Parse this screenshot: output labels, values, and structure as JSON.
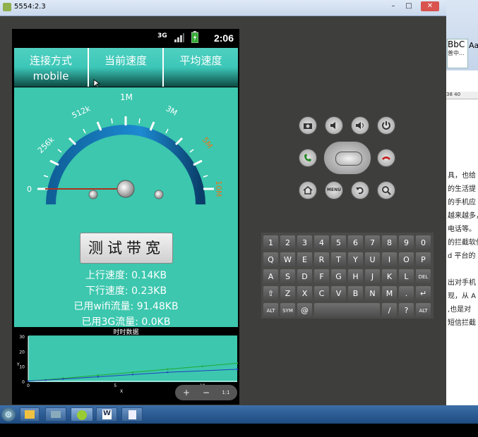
{
  "window": {
    "title": "5554:2.3",
    "minimize": "–",
    "maximize": "□",
    "close": "✕"
  },
  "status_bar": {
    "network": "3G",
    "time": "2:06"
  },
  "tabs": [
    {
      "label": "连接方式",
      "value": "mobile"
    },
    {
      "label": "当前速度"
    },
    {
      "label": "平均速度"
    }
  ],
  "gauge": {
    "labels": [
      "0",
      "256k",
      "512k",
      "1M",
      "3M",
      "5M",
      "10M"
    ],
    "needle_value": "0"
  },
  "test_button": "测试带宽",
  "stats": {
    "upload": "上行速度: 0.14KB",
    "download": "下行速度: 0.23KB",
    "wifi": "已用wifi流量: 91.48KB",
    "g3": "已用3G流量: 0.0KB"
  },
  "chart_data": {
    "type": "line",
    "title": "时时数据",
    "xlabel": "X",
    "ylabel": "Y",
    "x_ticks": [
      "0",
      "5",
      "10"
    ],
    "y_ticks": [
      "30",
      "20",
      "10",
      "0"
    ],
    "series": [
      {
        "name": "",
        "color": "#22aa33",
        "x": [
          0,
          2,
          4,
          6,
          8,
          10,
          12
        ],
        "y": [
          0.2,
          2,
          4,
          6,
          8,
          10,
          12
        ]
      },
      {
        "name": "",
        "color": "#2040c0",
        "x": [
          0,
          1,
          2,
          4,
          6,
          8,
          12
        ],
        "y": [
          0.1,
          0.8,
          1.5,
          3,
          4.5,
          6,
          8
        ]
      }
    ],
    "xlim": [
      0,
      12
    ],
    "ylim": [
      0,
      30
    ]
  },
  "zoom": {
    "zoom_in": "+",
    "zoom_out": "−",
    "reset": "1:1"
  },
  "keyboard": {
    "rows": [
      [
        "1",
        "2",
        "3",
        "4",
        "5",
        "6",
        "7",
        "8",
        "9",
        "0"
      ],
      [
        "Q",
        "W",
        "E",
        "R",
        "T",
        "Y",
        "U",
        "I",
        "O",
        "P"
      ],
      [
        "A",
        "S",
        "D",
        "F",
        "G",
        "H",
        "J",
        "K",
        "L",
        "DEL"
      ],
      [
        "⇧",
        "Z",
        "X",
        "C",
        "V",
        "B",
        "N",
        "M",
        ".",
        "↵"
      ],
      [
        "ALT",
        "SYM",
        "@",
        "",
        "",
        "",
        "",
        "/",
        "?",
        "ALT"
      ]
    ]
  },
  "document": {
    "style_sample": "BbC",
    "style_sample2": "Aa",
    "style_caption": "普中...",
    "ruler": "38  40",
    "lines": [
      "具，也给",
      "的生活提",
      "的手机应",
      "越来越多，",
      "电话等。",
      "的拦截软件",
      "d 平台的",
      "",
      "出对手机",
      "现，从 A",
      ",也是对",
      "短信拦截"
    ]
  },
  "taskbar": {
    "start": "⊙"
  }
}
